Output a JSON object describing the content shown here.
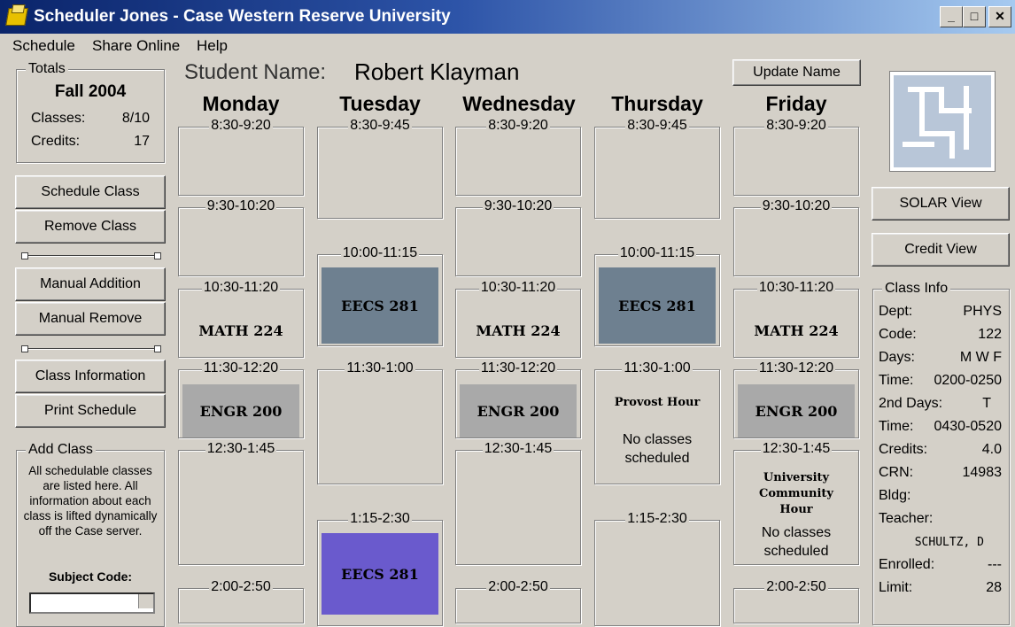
{
  "window": {
    "title": "Scheduler Jones - Case Western Reserve University",
    "minimize_icon": "_",
    "maximize_icon": "□",
    "close_icon": "✕"
  },
  "menu": [
    "Schedule",
    "Share Online",
    "Help"
  ],
  "totals": {
    "legend": "Totals",
    "term": "Fall 2004",
    "classes_label": "Classes:",
    "classes_value": "8/10",
    "credits_label": "Credits:",
    "credits_value": "17"
  },
  "buttons": {
    "schedule_class": "Schedule Class",
    "remove_class": "Remove Class",
    "manual_addition": "Manual Addition",
    "manual_remove": "Manual Remove",
    "class_information": "Class Information",
    "print_schedule": "Print Schedule",
    "update_name": "Update Name",
    "solar_view": "SOLAR View",
    "credit_view": "Credit View"
  },
  "add_class": {
    "legend": "Add Class",
    "description": "All schedulable classes are listed here. All information about each class is lifted dynamically off the Case server.",
    "subject_code_label": "Subject Code:"
  },
  "student": {
    "label": "Student Name:",
    "name": "Robert Klayman"
  },
  "days": [
    "Monday",
    "Tuesday",
    "Wednesday",
    "Thursday",
    "Friday"
  ],
  "schedule": {
    "mon": [
      "8:30-9:20",
      "9:30-10:20",
      "10:30-11:20",
      "11:30-12:20",
      "12:30-1:45",
      "2:00-2:50"
    ],
    "mon_classes": [
      "MATH 224",
      "ENGR 200"
    ],
    "tue": [
      "8:30-9:45",
      "10:00-11:15",
      "11:30-1:00",
      "1:15-2:30"
    ],
    "tue_classes": [
      "EECS 281",
      "EECS 281"
    ],
    "wed": [
      "8:30-9:20",
      "9:30-10:20",
      "10:30-11:20",
      "11:30-12:20",
      "12:30-1:45",
      "2:00-2:50"
    ],
    "wed_classes": [
      "MATH 224",
      "ENGR 200"
    ],
    "thu": [
      "8:30-9:45",
      "10:00-11:15",
      "11:30-1:00",
      "1:15-2:30"
    ],
    "thu_classes": [
      "EECS 281"
    ],
    "thu_special": {
      "title": "Provost Hour",
      "note": "No classes scheduled"
    },
    "fri": [
      "8:30-9:20",
      "9:30-10:20",
      "10:30-11:20",
      "11:30-12:20",
      "12:30-1:45",
      "2:00-2:50"
    ],
    "fri_classes": [
      "MATH 224",
      "ENGR 200"
    ],
    "fri_special": {
      "title": "University Community Hour",
      "note": "No classes scheduled"
    }
  },
  "colors": {
    "math": "#d4d0c8",
    "engr": "#a9a9a9",
    "eecs_selected": "#6e8090",
    "eecs_lab": "#6a5acd"
  },
  "class_info": {
    "legend": "Class Info",
    "rows": [
      {
        "label": "Dept:",
        "value": "PHYS"
      },
      {
        "label": "Code:",
        "value": "122"
      },
      {
        "label": "Days:",
        "value": "M W F"
      },
      {
        "label": "Time:",
        "value": "0200-0250"
      },
      {
        "label": "2nd Days:",
        "value": "T"
      },
      {
        "label": "Time:",
        "value": "0430-0520"
      },
      {
        "label": "Credits:",
        "value": "4.0"
      },
      {
        "label": "CRN:",
        "value": "14983"
      },
      {
        "label": "Bldg:",
        "value": ""
      },
      {
        "label": "Teacher:",
        "value": ""
      },
      {
        "label": "",
        "value": "SCHULTZ, D"
      },
      {
        "label": "Enrolled:",
        "value": "---"
      },
      {
        "label": "Limit:",
        "value": "28"
      }
    ]
  }
}
